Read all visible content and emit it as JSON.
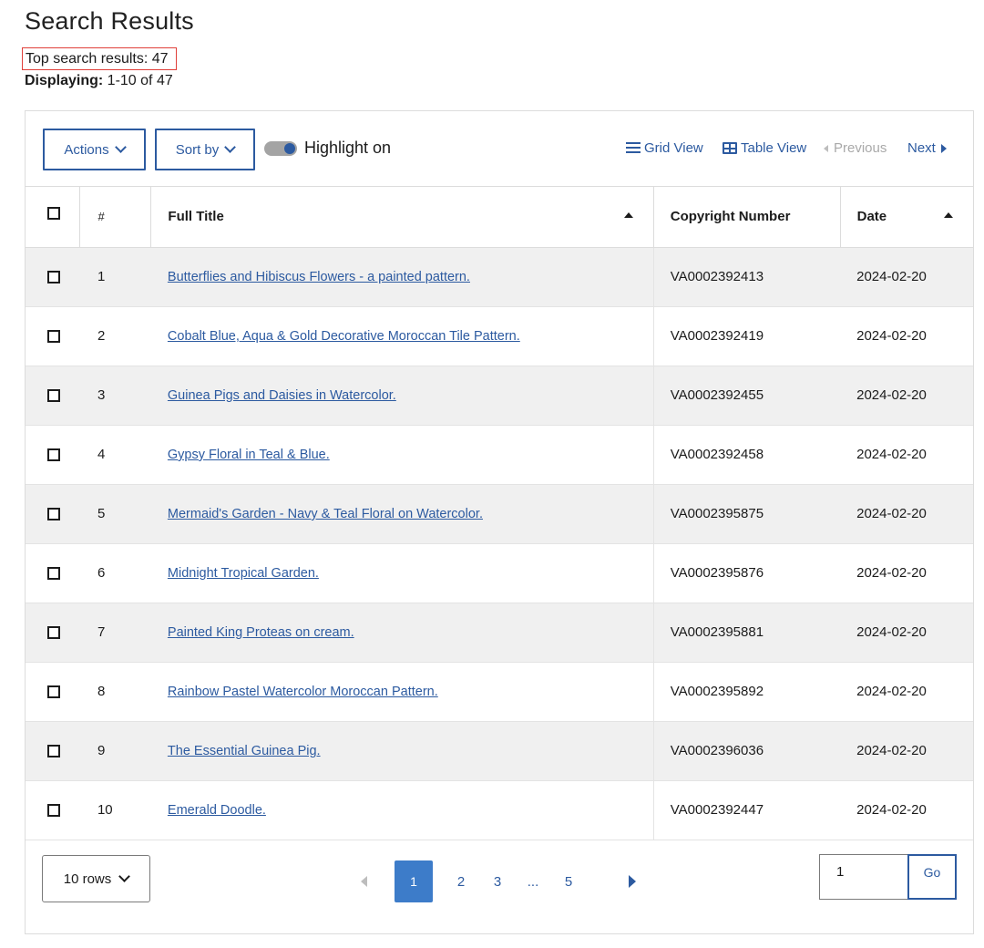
{
  "page_title": "Search Results",
  "top_results": "Top search results: 47",
  "displaying_label": "Displaying:",
  "displaying_value": " 1-10 of 47",
  "toolbar": {
    "actions_label": "Actions",
    "sort_label": "Sort by",
    "highlight_label": "Highlight on",
    "grid_view_label": "Grid View",
    "table_view_label": "Table View",
    "previous_label": "Previous",
    "next_label": "Next"
  },
  "table": {
    "headers": {
      "num": "#",
      "title": "Full Title",
      "copyright": "Copyright Number",
      "date": "Date"
    },
    "rows": [
      {
        "num": "1",
        "title": "Butterflies and Hibiscus Flowers - a painted pattern.",
        "copyright": "VA0002392413",
        "date": "2024-02-20"
      },
      {
        "num": "2",
        "title": "Cobalt Blue, Aqua & Gold Decorative Moroccan Tile Pattern.",
        "copyright": "VA0002392419",
        "date": "2024-02-20"
      },
      {
        "num": "3",
        "title": "Guinea Pigs and Daisies in Watercolor.",
        "copyright": "VA0002392455",
        "date": "2024-02-20"
      },
      {
        "num": "4",
        "title": "Gypsy Floral in Teal & Blue.",
        "copyright": "VA0002392458",
        "date": "2024-02-20"
      },
      {
        "num": "5",
        "title": "Mermaid's Garden - Navy & Teal Floral on Watercolor.",
        "copyright": "VA0002395875",
        "date": "2024-02-20"
      },
      {
        "num": "6",
        "title": "Midnight Tropical Garden.",
        "copyright": "VA0002395876",
        "date": "2024-02-20"
      },
      {
        "num": "7",
        "title": "Painted King Proteas on cream.",
        "copyright": "VA0002395881",
        "date": "2024-02-20"
      },
      {
        "num": "8",
        "title": "Rainbow Pastel Watercolor Moroccan Pattern.",
        "copyright": "VA0002395892",
        "date": "2024-02-20"
      },
      {
        "num": "9",
        "title": "The Essential Guinea Pig.",
        "copyright": "VA0002396036",
        "date": "2024-02-20"
      },
      {
        "num": "10",
        "title": "Emerald Doodle.",
        "copyright": "VA0002392447",
        "date": "2024-02-20"
      }
    ]
  },
  "footer": {
    "rows_label": "10 rows",
    "pages": [
      "1",
      "2",
      "3",
      "...",
      "5"
    ],
    "page_input_value": "1",
    "go_label": "Go"
  },
  "colors": {
    "accent": "#2c5aa0",
    "active_page": "#3d7cc9",
    "highlight_box": "#e0403a",
    "row_stripe": "#f0f0f0"
  }
}
